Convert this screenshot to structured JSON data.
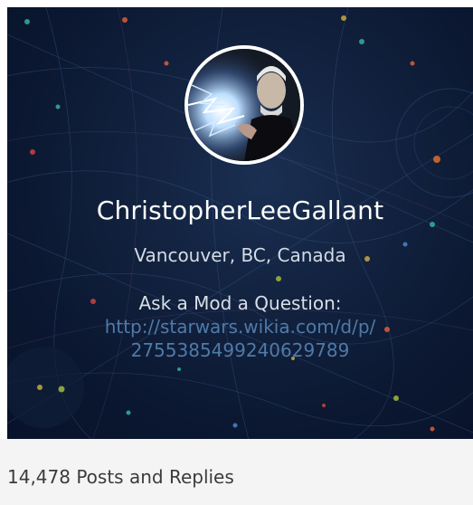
{
  "profile": {
    "username": "ChristopherLeeGallant",
    "location": "Vancouver, BC, Canada",
    "bio_line": "Ask a Mod a Question:",
    "bio_link_line1": "http://starwars.wikia.com/d/p/",
    "bio_link_line2": "2755385499240629789"
  },
  "stats": {
    "posts_and_replies": "14,478 Posts and Replies"
  },
  "colors": {
    "hero_background": "#0b1730",
    "link": "#4f7aa8",
    "footer_background": "#f4f4f5"
  },
  "icons": {
    "avatar": "profile-photo"
  }
}
